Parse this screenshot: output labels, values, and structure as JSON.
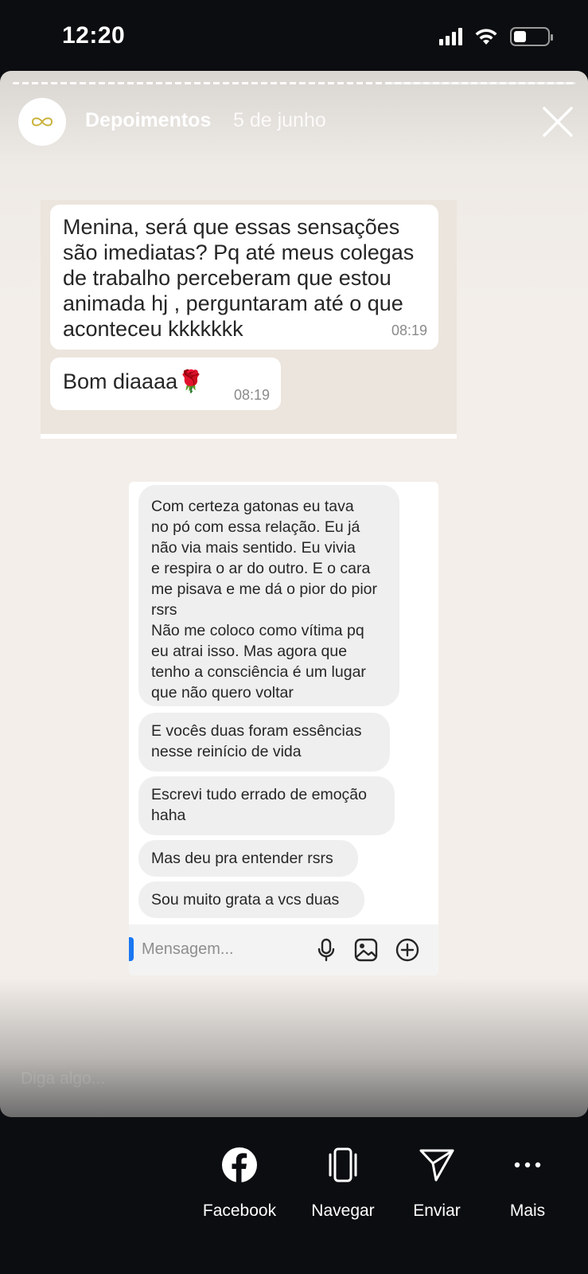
{
  "status_bar": {
    "time": "12:20"
  },
  "story": {
    "username": "Depoimentos",
    "date": "5 de junho",
    "reply_placeholder": "Diga algo..."
  },
  "whatsapp_screenshot": {
    "messages": [
      {
        "lines": [
          "Menina, será que essas sensações",
          "são imediatas? Pq até meus colegas",
          "de trabalho perceberam que estou",
          "animada hj , perguntaram até o que",
          "aconteceu kkkkkkk"
        ],
        "time": "08:19"
      },
      {
        "text": "Bom diaaaa🌹",
        "time": "08:19"
      }
    ]
  },
  "dm_screenshot": {
    "messages": [
      {
        "lines": [
          "Com certeza gatonas eu tava",
          "no pó com essa relação. Eu já",
          "não via mais sentido. Eu vivia",
          "e respira o ar do outro. E o cara",
          "me pisava e me dá o pior do pior",
          "rsrs",
          "Não me coloco como vítima pq",
          "eu atrai isso. Mas agora que",
          "tenho a consciência é um lugar",
          "que não quero voltar"
        ]
      },
      {
        "lines": [
          "E vocês duas foram essências",
          "nesse reinício de vida"
        ]
      },
      {
        "lines": [
          "Escrevi tudo errado de emoção",
          "haha"
        ]
      },
      {
        "lines": [
          "Mas deu pra entender rsrs"
        ]
      },
      {
        "lines": [
          "Sou muito grata a vcs duas"
        ]
      }
    ],
    "input_placeholder": "Mensagem..."
  },
  "actions": [
    {
      "label": "Facebook",
      "icon": "facebook-icon"
    },
    {
      "label": "Navegar",
      "icon": "navigate-icon"
    },
    {
      "label": "Enviar",
      "icon": "send-icon"
    },
    {
      "label": "Mais",
      "icon": "more-icon"
    }
  ],
  "colors": {
    "background": "#0b0d10",
    "story_bg": "#f3eee9",
    "whatsapp_bg": "#ece5dd",
    "dm_accent": "#1a77f2"
  }
}
